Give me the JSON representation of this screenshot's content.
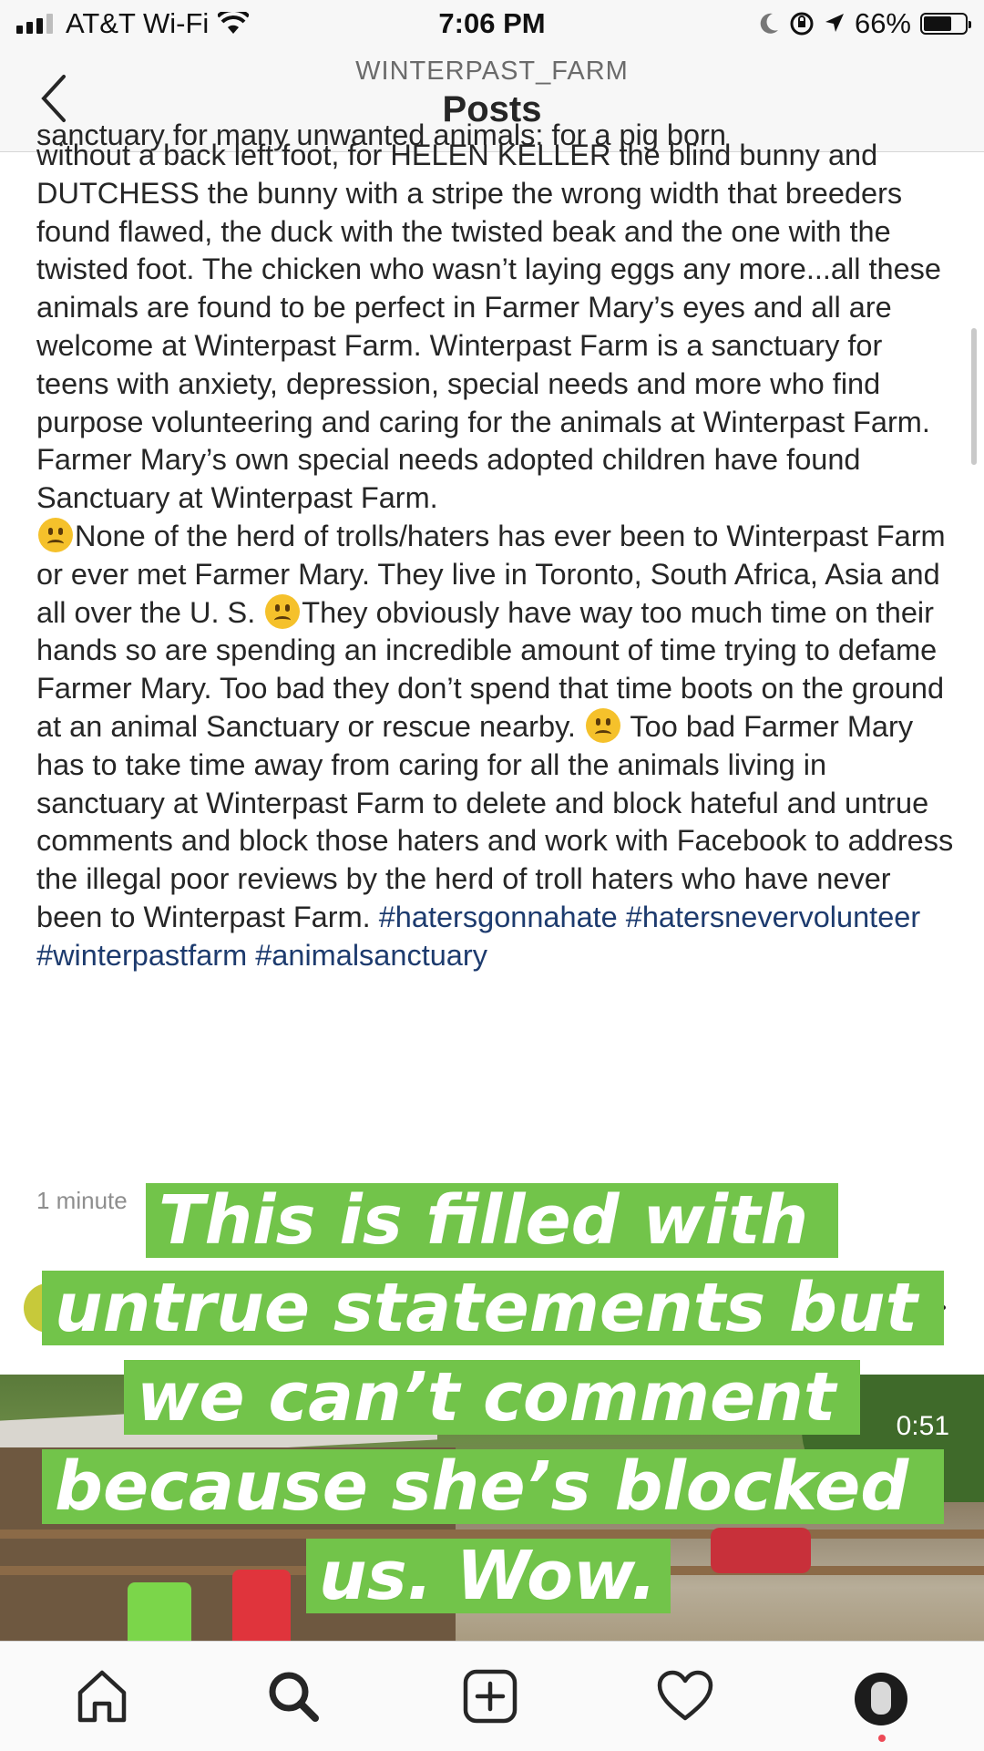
{
  "status_bar": {
    "carrier": "AT&T Wi-Fi",
    "time": "7:06 PM",
    "battery": "66%"
  },
  "header": {
    "account": "WINTERPAST_FARM",
    "title": "Posts"
  },
  "caption": {
    "cut_line": "sanctuary for many unwanted animals: for a pig born",
    "para1": "without a back left foot, for HELEN KELLER the blind bunny and DUTCHESS the bunny with a stripe the wrong width that breeders found flawed, the duck with the twisted beak and the one with the twisted foot. The chicken who wasn’t laying eggs any more...all these animals are found to be perfect in Farmer Mary’s eyes and all are welcome at Winterpast Farm. Winterpast Farm is a sanctuary for teens with anxiety, depression, special needs and more who find purpose volunteering and caring for the animals at Winterpast Farm. Farmer Mary’s own special needs adopted children have found Sanctuary at Winterpast Farm.",
    "para2_a": "None of the herd of trolls/haters has ever been to Winterpast Farm or ever met Farmer Mary. They live in Toronto, South Africa, Asia and all over the U. S.",
    "para2_b": "They obviously have way too much time on their hands so are spending an incredible amount of time  trying to defame Farmer Mary.  Too bad they don’t spend that time boots on the ground at an animal Sanctuary or rescue nearby.",
    "para2_c": "Too bad Farmer Mary has to take time away from caring for all the animals living in sanctuary at Winterpast Farm to delete and block hateful and untrue comments and block those haters and work with Facebook to address the illegal poor reviews by the herd of  troll haters who have never been to Winterpast Farm.",
    "hashtags": "#hatersgonnahate #hatersnevervolunteer #winterpastfarm #animalsanctuary"
  },
  "timestamp": "1 minute",
  "video_duration": "0:51",
  "overlay_lines": [
    "This is filled with",
    "untrue statements but",
    "we can’t comment",
    "because she’s blocked",
    "us. Wow."
  ],
  "icons": {
    "home": "home-icon",
    "search": "search-icon",
    "new_post": "add-post-icon",
    "activity": "heart-icon",
    "profile": "profile-avatar"
  },
  "colors": {
    "overlay_bg": "#72c44a",
    "hashtag": "#1d3b6e",
    "notification": "#ed4956"
  }
}
